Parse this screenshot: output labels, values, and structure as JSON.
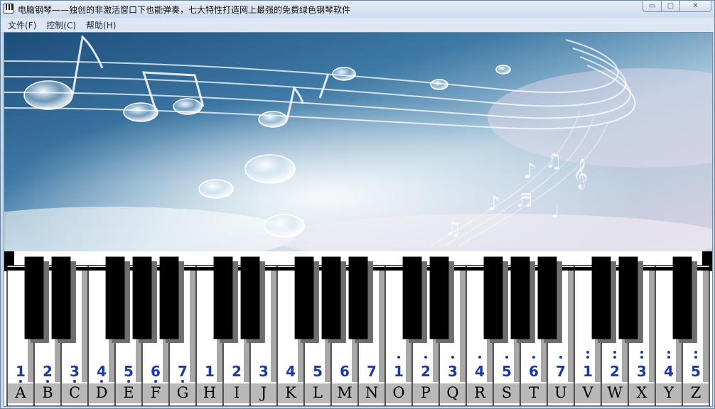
{
  "window": {
    "title": "电脑钢琴——独创的非激活窗口下也能弹奏，七大特性打造网上最强的免费绿色钢琴软件",
    "min_glyph": "▭",
    "max_glyph": "▢",
    "close_glyph": "✕"
  },
  "menu": [
    {
      "label": "文件(F)"
    },
    {
      "label": "控制(C)"
    },
    {
      "label": "帮助(H)"
    }
  ],
  "piano": {
    "white_keys": [
      {
        "letter": "A",
        "note": "1",
        "octave": -1
      },
      {
        "letter": "B",
        "note": "2",
        "octave": -1
      },
      {
        "letter": "C",
        "note": "3",
        "octave": -1
      },
      {
        "letter": "D",
        "note": "4",
        "octave": -1
      },
      {
        "letter": "E",
        "note": "5",
        "octave": -1
      },
      {
        "letter": "F",
        "note": "6",
        "octave": -1
      },
      {
        "letter": "G",
        "note": "7",
        "octave": -1
      },
      {
        "letter": "H",
        "note": "1",
        "octave": 0
      },
      {
        "letter": "I",
        "note": "2",
        "octave": 0
      },
      {
        "letter": "J",
        "note": "3",
        "octave": 0
      },
      {
        "letter": "K",
        "note": "4",
        "octave": 0
      },
      {
        "letter": "L",
        "note": "5",
        "octave": 0
      },
      {
        "letter": "M",
        "note": "6",
        "octave": 0
      },
      {
        "letter": "N",
        "note": "7",
        "octave": 0
      },
      {
        "letter": "O",
        "note": "1",
        "octave": 1
      },
      {
        "letter": "P",
        "note": "2",
        "octave": 1
      },
      {
        "letter": "Q",
        "note": "3",
        "octave": 1
      },
      {
        "letter": "R",
        "note": "4",
        "octave": 1
      },
      {
        "letter": "S",
        "note": "5",
        "octave": 1
      },
      {
        "letter": "T",
        "note": "6",
        "octave": 1
      },
      {
        "letter": "U",
        "note": "7",
        "octave": 1
      },
      {
        "letter": "V",
        "note": "1",
        "octave": 2
      },
      {
        "letter": "W",
        "note": "2",
        "octave": 2
      },
      {
        "letter": "X",
        "note": "3",
        "octave": 2
      },
      {
        "letter": "Y",
        "note": "4",
        "octave": 2
      },
      {
        "letter": "Z",
        "note": "5",
        "octave": 2
      }
    ],
    "note_color": "#1a3aa8",
    "letter_color": "#000000"
  }
}
